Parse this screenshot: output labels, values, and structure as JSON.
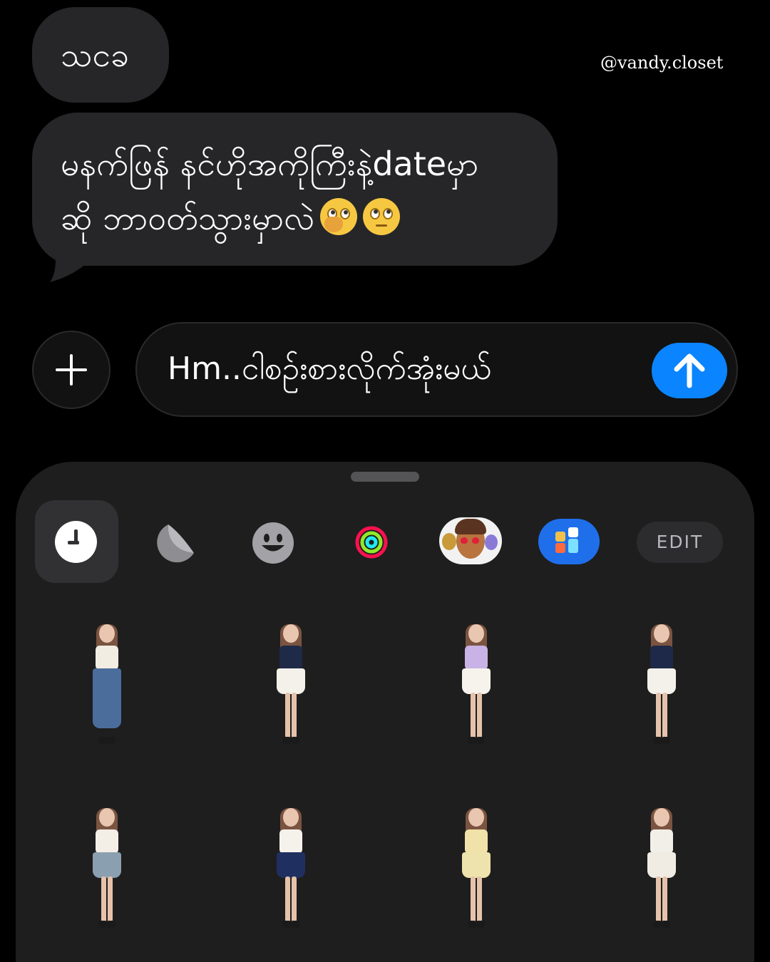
{
  "watermark": "@vandy.closet",
  "messages": [
    {
      "text": "သငခ"
    },
    {
      "line1": "မနက်ဖြန် နင်ဟိုအကိုကြီးနဲ့dateမှာ",
      "line2": "ဆို ဘာဝတ်သွားမှာလဲ",
      "emojis": [
        "face-with-hand-over-mouth-emoji",
        "face-with-rolling-eyes-emoji"
      ]
    }
  ],
  "composer": {
    "input_value": "Hm..ငါစဉ်းစားလိုက်အုံးမယ်",
    "send_color": "#0a84ff"
  },
  "sticker_drawer": {
    "tabs": [
      {
        "icon": "clock-icon",
        "selected": true
      },
      {
        "icon": "moon-sticker-icon"
      },
      {
        "icon": "smiley-icon"
      },
      {
        "icon": "activity-rings-icon"
      },
      {
        "icon": "memoji-icon"
      },
      {
        "icon": "app-grid-icon"
      }
    ],
    "edit_label": "EDIT",
    "stickers": [
      {
        "top": "#f2ede2",
        "bottom": "#4a6d9c",
        "long": true
      },
      {
        "top": "#1f2a48",
        "bottom": "#f4f1ea"
      },
      {
        "top": "#c9b3e6",
        "bottom": "#f6f3ec"
      },
      {
        "top": "#1e2848",
        "bottom": "#f4f1ea"
      },
      {
        "top": "#f3eee6",
        "bottom": "#8aa0b0"
      },
      {
        "top": "#f5f2ec",
        "bottom": "#1f3060"
      },
      {
        "top": "#f0e2a8",
        "bottom": "#efe3ad"
      },
      {
        "top": "#f2efe8",
        "bottom": "#f0ece4"
      }
    ]
  }
}
